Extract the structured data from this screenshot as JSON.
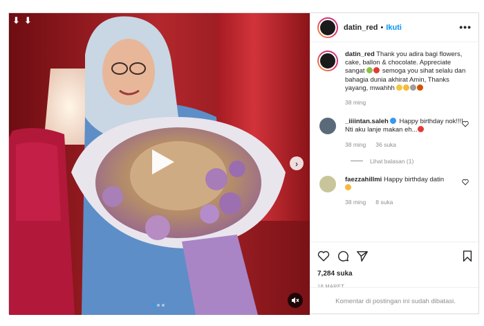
{
  "post": {
    "username": "datin_red",
    "separator": "•",
    "follow_label": "Ikuti",
    "more_label": "•••"
  },
  "media": {
    "top_icons": [
      "⬇",
      "⬇"
    ],
    "next_label": "›"
  },
  "caption": {
    "username": "datin_red",
    "text_1": "Thank you adira bagi flowers, cake, ballon & chocolate. Appreciate sangat",
    "text_2": "semoga you sihat selalu dan bahagia dunia akhirat Amin, Thanks yayang, mwahhh",
    "time": "38 ming"
  },
  "comments": [
    {
      "username": "_iiiintan.saleh",
      "text": "Happy birthday nok!!!! Nti aku lanje makan eh...",
      "time": "38 ming",
      "likes": "36 suka",
      "replies": "Lihat balasan (1)"
    },
    {
      "username": "faezzahillmi",
      "text": "Happy birthday datin",
      "time": "38 ming",
      "likes": "8 suka"
    }
  ],
  "footer": {
    "likes": "7,284 suka",
    "date": "18 MARET",
    "comments_disabled": "Komentar di postingan ini sudah dibatasi."
  },
  "colors": {
    "link": "#0095f6",
    "muted": "#8e8e8e",
    "verified": "#3897f0"
  }
}
